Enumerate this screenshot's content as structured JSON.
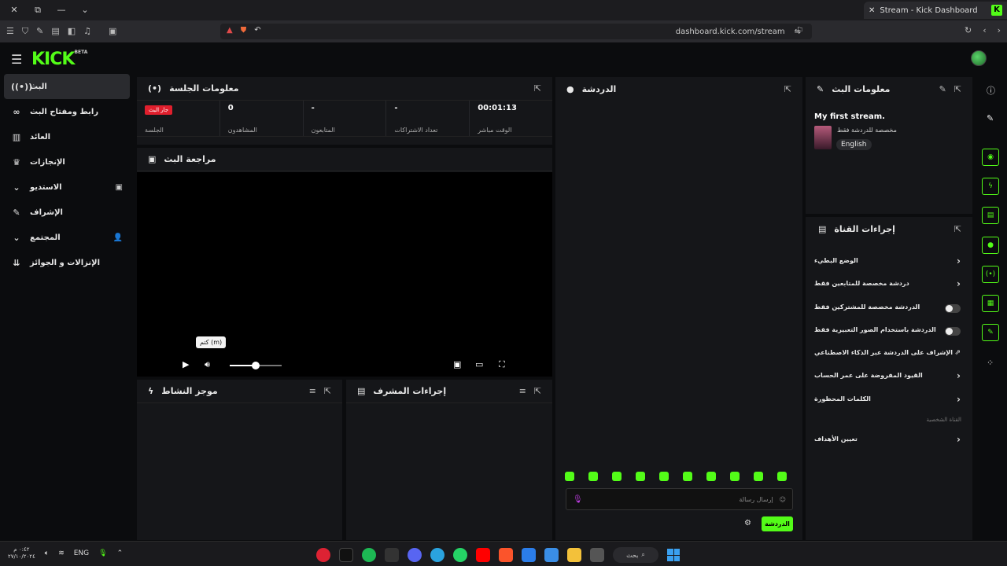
{
  "browser": {
    "tab_title": "Stream - Kick Dashboard",
    "tab_favicon": "K",
    "url": "dashboard.kick.com/stream",
    "icons": [
      "sidebar-icon",
      "shield-icon",
      "pin-icon",
      "reader-icon",
      "split-icon",
      "music-icon",
      "wallet-icon",
      "brave-shield-icon",
      "rewards-icon",
      "back-icon",
      "reload-icon",
      "bookmark-icon"
    ]
  },
  "app": {
    "logo": "KICK",
    "logo_sup": "BETA",
    "accent": "#53fc18",
    "live_color": "#e01f2d"
  },
  "sidebar": {
    "items": [
      {
        "label": "البث",
        "icon": "broadcast-icon",
        "active": true
      },
      {
        "label": "رابط ومفتاح البث",
        "icon": "link-icon"
      },
      {
        "label": "العائد",
        "icon": "chart-icon"
      },
      {
        "label": "الإنجازات",
        "icon": "trophy-icon"
      },
      {
        "label": "الاستديو",
        "icon": "chevron-down-icon"
      },
      {
        "label": "الإشراف",
        "icon": "wrench-icon"
      },
      {
        "label": "المجتمع",
        "icon": "chevron-down-icon"
      },
      {
        "label": "الإنزالات و الجوائز",
        "icon": "drops-icon"
      }
    ]
  },
  "session": {
    "title": "معلومات الجلسة",
    "live_badge": "جار البث",
    "session_label": "الجلسة",
    "stats": [
      {
        "value": "0",
        "label": "المشاهدون"
      },
      {
        "value": "-",
        "label": "المتابعون"
      },
      {
        "value": "-",
        "label": "تعداد الاشتراكات"
      },
      {
        "value": "00:01:13",
        "label": "الوقت مباشر"
      }
    ]
  },
  "preview": {
    "title": "مراجعة البث",
    "tooltip": "كتم (m)",
    "volume_fraction": 0.5
  },
  "activity": {
    "title": "موجز النشاط"
  },
  "mod_actions": {
    "title": "إجراءات المشرف"
  },
  "chat": {
    "title": "الدردشة",
    "placeholder": "إرسال رسالة",
    "send_label": "الدردشة"
  },
  "stream_info": {
    "title": "معلومات البث",
    "stream_title": "My first stream.",
    "category": "مخصصة للدردشة فقط",
    "language": "English"
  },
  "channel_actions": {
    "title": "إجراءات القناة",
    "rows": [
      {
        "label": "الوضع البطيء",
        "control": "arrow"
      },
      {
        "label": "دردشة مخصصة للمتابعين فقط",
        "control": "arrow"
      },
      {
        "label": "الدردشة مخصصة للمشتركين فقط",
        "control": "toggle"
      },
      {
        "label": "الدردشة باستخدام الصور التعبيرية فقط",
        "control": "toggle"
      },
      {
        "label": "الإشراف على الدردشة عبر الذكاء الاصطناعي",
        "control": "external"
      },
      {
        "label": "القيود المفروضة على عمر الحساب",
        "control": "arrow"
      },
      {
        "label": "الكلمات المحظورة",
        "control": "arrow"
      },
      {
        "label": "تعيين الأهداف",
        "control": "arrow"
      }
    ],
    "section_label": "القناة الشخصية"
  },
  "taskbar": {
    "clock_time": "٠:٤٢ م",
    "clock_date": "٢٧/١٠/٢٠٢٤",
    "lang": "ENG",
    "search_label": "بحث"
  }
}
